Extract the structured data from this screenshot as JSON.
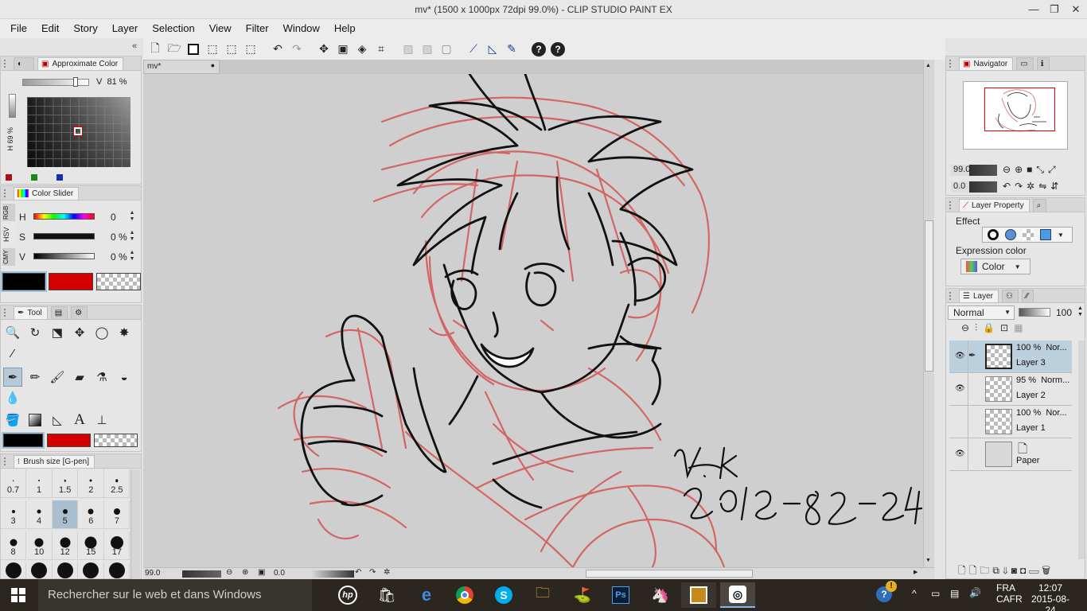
{
  "window": {
    "title": "mv* (1500 x 1000px 72dpi 99.0%)  - CLIP STUDIO PAINT EX",
    "minimize": "—",
    "maximize": "❐",
    "close": "✕"
  },
  "menu": [
    "File",
    "Edit",
    "Story",
    "Layer",
    "Selection",
    "View",
    "Filter",
    "Window",
    "Help"
  ],
  "toolbar": {
    "icons": [
      "new-file-icon",
      "open-folder-icon",
      "save-icon",
      "select-icon",
      "select-add-icon",
      "select-sub-icon",
      "undo-icon",
      "redo-icon",
      "transform-icon",
      "resize-icon",
      "fill-icon",
      "crop-icon",
      "clear-icon",
      "clear-outside-icon",
      "deselect-icon",
      "ruler-snap-icon",
      "ruler-icon",
      "pen-snap-icon",
      "help-icon",
      "help-icon-2"
    ],
    "help_label": "?"
  },
  "color_panel": {
    "tab_label": "Approximate Color",
    "v_label": "V",
    "v_value": "81 %",
    "side_label": "H 69 %",
    "accent_colors": [
      "#b01010",
      "#1a8a1a",
      "#1030b0"
    ]
  },
  "color_slider": {
    "tab_label": "Color Slider",
    "side_tabs": [
      "RGB",
      "HSV",
      "CMY"
    ],
    "rows": [
      {
        "label": "H",
        "value": "0",
        "unit": ""
      },
      {
        "label": "S",
        "value": "0",
        "unit": "%"
      },
      {
        "label": "V",
        "value": "0",
        "unit": "%"
      }
    ],
    "main_color": "#000000",
    "sub_color": "#d40000"
  },
  "tool_panel": {
    "tab_label": "Tool",
    "groups": [
      [
        "zoom-icon",
        "rotate-icon",
        "object-icon",
        "move-layer-icon",
        "lasso-icon",
        "magic-wand-icon",
        "eyedropper-icon"
      ],
      [
        "pen-icon",
        "pencil-icon",
        "brush-icon",
        "airbrush-icon",
        "decoration-icon",
        "eraser-icon",
        "blend-icon"
      ],
      [
        "fill-icon",
        "gradient-icon",
        "figure-icon",
        "text-icon",
        "balloon-icon"
      ]
    ],
    "text_glyph": "A"
  },
  "brush_panel": {
    "tab_label": "Brush size [G-pen]",
    "sizes": [
      "0.7",
      "1",
      "1.5",
      "2",
      "2.5",
      "3",
      "4",
      "5",
      "6",
      "7",
      "8",
      "10",
      "12",
      "15",
      "17"
    ],
    "selected": "5"
  },
  "document": {
    "tab_label": "mv*",
    "signature_line1": "N.k",
    "signature_line2": "2015-08-24",
    "zoom": "99.0",
    "rotation": "0.0"
  },
  "navigator": {
    "tab_label": "Navigator",
    "zoom": "99.0",
    "rotation": "0.0"
  },
  "layer_property": {
    "tab_label": "Layer Property",
    "effect_label": "Effect",
    "expression_label": "Expression color",
    "expression_value": "Color"
  },
  "layer_panel": {
    "tab_label": "Layer",
    "blend_mode": "Normal",
    "opacity": "100",
    "layers": [
      {
        "percent": "100 %",
        "mode": "Nor...",
        "name": "Layer 3",
        "visible": true,
        "selected": true
      },
      {
        "percent": "95 %",
        "mode": "Norm...",
        "name": "Layer 2",
        "visible": true,
        "selected": false
      },
      {
        "percent": "100 %",
        "mode": "Nor...",
        "name": "Layer 1",
        "visible": false,
        "selected": false
      },
      {
        "percent": "",
        "mode": "",
        "name": "Paper",
        "visible": true,
        "selected": false
      }
    ]
  },
  "taskbar": {
    "search_placeholder": "Rechercher sur le web et dans Windows",
    "apps": [
      "hp-icon",
      "store-icon",
      "edge-icon",
      "chrome-icon",
      "skype-icon",
      "explorer-icon",
      "golf-icon",
      "photoshop-icon",
      "pony-icon",
      "sketchbook-icon",
      "clip-studio-icon"
    ],
    "ps_label": "Ps",
    "lang_line1": "FRA",
    "lang_line2": "CAFR",
    "time": "12:07",
    "date": "2015-08-24"
  }
}
